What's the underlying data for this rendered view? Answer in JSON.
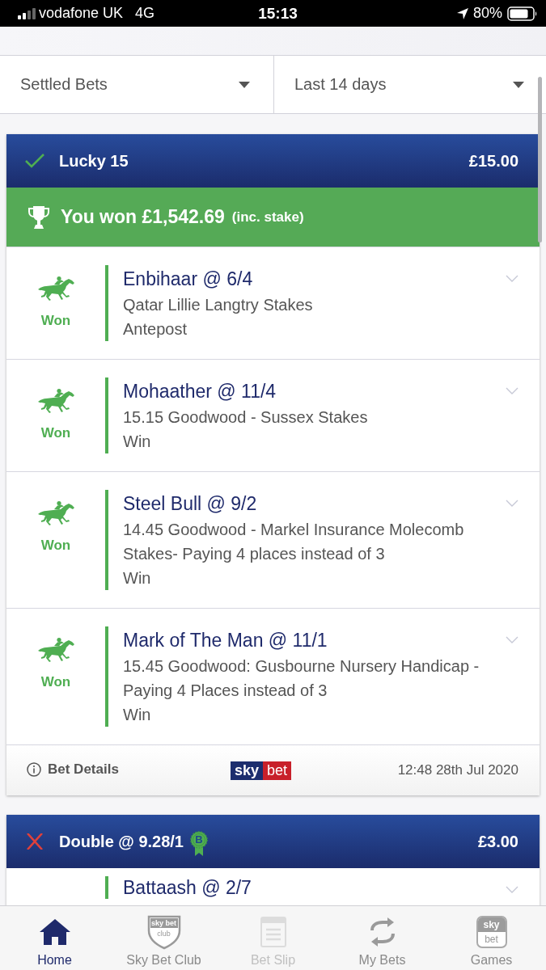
{
  "status_bar": {
    "carrier": "vodafone UK",
    "network": "4G",
    "time": "15:13",
    "battery": "80%"
  },
  "filters": [
    {
      "label": "Settled Bets"
    },
    {
      "label": "Last 14 days"
    }
  ],
  "bets": [
    {
      "kind": "won",
      "title": "Lucky 15",
      "stake": "£15.00",
      "winnings": {
        "amount": "You won £1,542.69",
        "note": "(inc. stake)"
      },
      "selections": [
        {
          "won": true,
          "result": "Won",
          "name": "Enbihaar @ 6/4",
          "lines": [
            "Qatar Lillie Langtry Stakes",
            "Antepost"
          ]
        },
        {
          "won": true,
          "result": "Won",
          "name": "Mohaather @ 11/4",
          "lines": [
            "15.15 Goodwood - Sussex Stakes",
            "Win"
          ]
        },
        {
          "won": true,
          "result": "Won",
          "name": "Steel Bull @ 9/2",
          "lines": [
            "14.45 Goodwood - Markel Insurance Molecomb Stakes- Paying 4 places instead of 3",
            "Win"
          ]
        },
        {
          "won": true,
          "result": "Won",
          "name": "Mark of The Man @ 11/1",
          "lines": [
            "15.45 Goodwood: Gusbourne Nursery Handicap - Paying 4 Places instead of 3",
            "Win"
          ]
        }
      ],
      "footer": {
        "details": "Bet Details",
        "logo": [
          "sky",
          "bet"
        ],
        "placed": "12:48 28th Jul 2020"
      }
    },
    {
      "kind": "lost",
      "title": "Double @ 9.28/1",
      "badge": "B",
      "stake": "£3.00",
      "selections": [
        {
          "won": true,
          "name": "Battaash @ 2/7"
        }
      ]
    }
  ],
  "tab_bar": [
    {
      "kind": "home",
      "label": "Home",
      "selected": true,
      "disabled": false
    },
    {
      "kind": "club",
      "label": "Sky Bet Club",
      "logo_lines": [
        "sky bet",
        "club"
      ],
      "selected": false,
      "disabled": false
    },
    {
      "kind": "slip",
      "label": "Bet Slip",
      "selected": false,
      "disabled": true
    },
    {
      "kind": "swap",
      "label": "My Bets",
      "selected": false,
      "disabled": false
    },
    {
      "kind": "games",
      "label": "Games",
      "logo_lines": [
        "sky",
        "bet"
      ],
      "selected": false,
      "disabled": false
    }
  ]
}
